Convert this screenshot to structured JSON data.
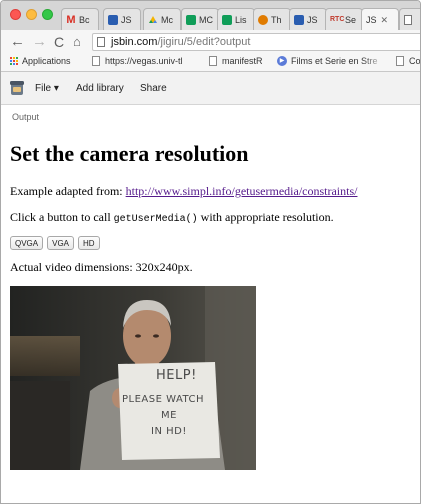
{
  "browser": {
    "tabs": [
      {
        "label": "Bc",
        "icon": "gmail-icon",
        "color": "#d93025"
      },
      {
        "label": "JS",
        "icon": "jsbin-icon",
        "color": "#2a5db0"
      },
      {
        "label": "Mc",
        "icon": "drive-icon",
        "color": "#f4b400"
      },
      {
        "label": "MC",
        "icon": "sheets-icon",
        "color": "#0f9d58"
      },
      {
        "label": "Lis",
        "icon": "sheets-icon",
        "color": "#0f9d58"
      },
      {
        "label": "Th",
        "icon": "hypothesis-icon",
        "color": "#e07b00"
      },
      {
        "label": "JS",
        "icon": "jsbin-icon",
        "color": "#2a5db0"
      },
      {
        "label": "Se",
        "icon": "webrtc-icon",
        "color": "#c0392b"
      },
      {
        "label": "JS",
        "icon": "close-icon",
        "color": "#666666",
        "active": true
      },
      {
        "label": "",
        "icon": "page-icon",
        "color": "#888888"
      }
    ],
    "url_domain": "jsbin.com",
    "url_path": "/jigiru/5/edit?output",
    "bookmarks": [
      {
        "label": "Applications",
        "icon": "apps-icon"
      },
      {
        "label": "https://vegas.univ-tl",
        "icon": "page-icon"
      },
      {
        "label": "manifestR",
        "icon": "page-icon"
      },
      {
        "label": "Films et Serie en Stre",
        "icon": "play-icon"
      },
      {
        "label": "Co",
        "icon": "page-icon"
      }
    ]
  },
  "jsbin": {
    "menu": [
      {
        "label": "File ▾"
      },
      {
        "label": "Add library"
      },
      {
        "label": "Share"
      }
    ],
    "output_label": "Output"
  },
  "page": {
    "title": "Set the camera resolution",
    "intro_prefix": "Example adapted from: ",
    "intro_link": "http://www.simpl.info/getusermedia/constraints/",
    "instruction_prefix": "Click a button to call ",
    "instruction_code": "getUserMedia()",
    "instruction_suffix": " with appropriate resolution.",
    "buttons": [
      "QVGA",
      "VGA",
      "HD"
    ],
    "dimensions_text": "Actual video dimensions: 320x240px.",
    "sign_text": [
      "HELP!",
      "PLEASE WATCH",
      "ME",
      "IN HD!"
    ]
  },
  "colors": {
    "link": "#551a8b",
    "accent_red": "#fc5753",
    "accent_yellow": "#fdbc40",
    "accent_green": "#33c748"
  }
}
